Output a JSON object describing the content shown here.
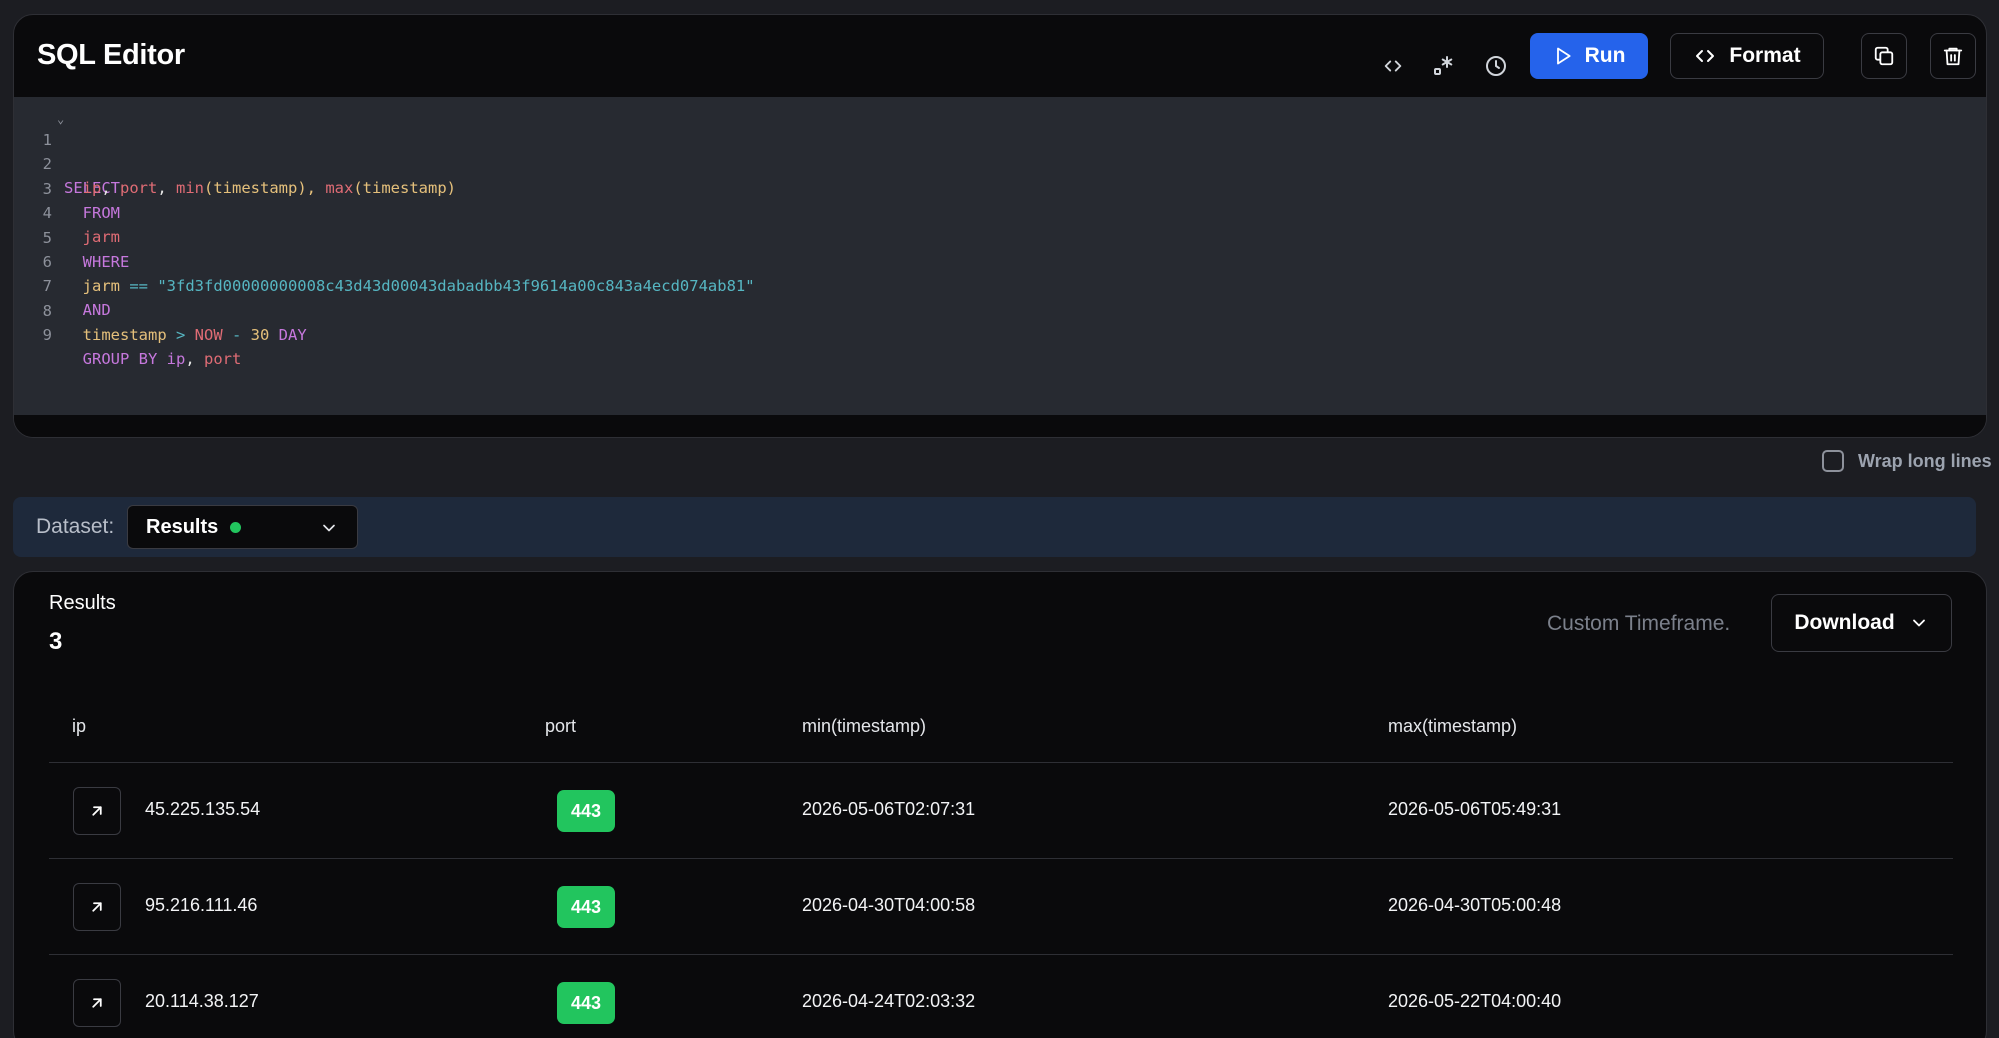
{
  "editor": {
    "title": "SQL Editor",
    "run_label": "Run",
    "format_label": "Format",
    "icons": [
      "code-icon",
      "regex-icon",
      "history-icon",
      "play-icon",
      "code-icon",
      "copy-icon",
      "trash-icon"
    ],
    "line_numbers": [
      "1",
      "2",
      "3",
      "4",
      "5",
      "6",
      "7",
      "8",
      "9"
    ],
    "code": {
      "l1": "SELECT",
      "l2_ip": "ip",
      "l2_comma1": ", ",
      "l2_port": "port",
      "l2_comma2": ", ",
      "l2_min": "min",
      "l2_arg1": "(timestamp), ",
      "l2_max": "max",
      "l2_arg2": "(timestamp)",
      "l3": "FROM",
      "l4": "jarm",
      "l5": "WHERE",
      "l6_col": "jarm",
      "l6_op": " == ",
      "l6_str": "\"3fd3fd00000000008c43d43d00043dabadbb43f9614a00c843a4ecd074ab81\"",
      "l7": "AND",
      "l8_col": "timestamp",
      "l8_gt": " > ",
      "l8_now": "NOW",
      "l8_minus": " - ",
      "l8_num": "30",
      "l8_day": " DAY",
      "l9_kw": "GROUP BY ",
      "l9_ip": "ip",
      "l9_comma": ", ",
      "l9_port": "port"
    }
  },
  "wrap_toggle": {
    "label": "Wrap long lines",
    "checked": false
  },
  "dataset": {
    "label": "Dataset:",
    "selected": "Results"
  },
  "results": {
    "title": "Results",
    "count": "3",
    "timeframe": "Custom Timeframe.",
    "download_label": "Download",
    "columns": [
      "ip",
      "port",
      "min(timestamp)",
      "max(timestamp)"
    ],
    "rows": [
      {
        "ip": "45.225.135.54",
        "port": "443",
        "min": "2026-05-06T02:07:31",
        "max": "2026-05-06T05:49:31"
      },
      {
        "ip": "95.216.111.46",
        "port": "443",
        "min": "2026-04-30T04:00:58",
        "max": "2026-04-30T05:00:48"
      },
      {
        "ip": "20.114.38.127",
        "port": "443",
        "min": "2026-04-24T02:03:32",
        "max": "2026-05-22T04:00:40"
      }
    ]
  },
  "colors": {
    "accent": "#2563eb",
    "success": "#22c55e",
    "panel": "#0a0a0c",
    "code_bg": "#272a31",
    "dataset_bar": "#1e293b"
  }
}
